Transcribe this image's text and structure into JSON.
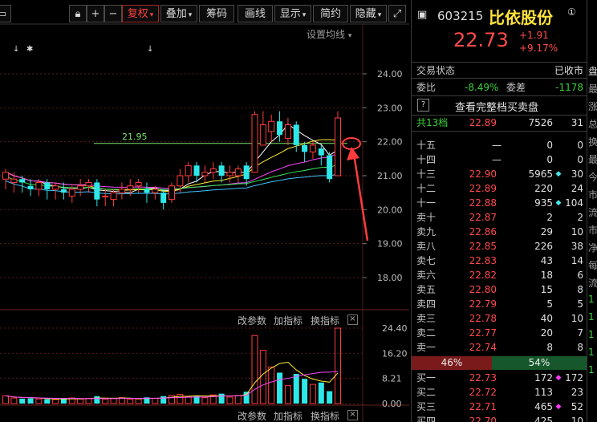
{
  "toolbar": {
    "icons": [
      "window-icon",
      "lock-icon",
      "plus-icon",
      "minus-icon"
    ],
    "fq_label": "复权",
    "overlay_label": "叠加",
    "chips_label": "筹码",
    "draw_label": "画线",
    "display_label": "显示",
    "simple_label": "简约",
    "hide_label": "隐藏",
    "expand_icon": "expand-icon"
  },
  "chart": {
    "ma_setting": "设置均线",
    "markers": [
      "↓",
      "✱",
      "↓"
    ],
    "ref_line_label": "21.95",
    "ref_line_price": 21.95,
    "y_ticks": [
      "24.00",
      "23.00",
      "22.00",
      "21.00",
      "20.00",
      "19.00",
      "18.00"
    ],
    "vol_ticks": [
      "24.40",
      "16.20",
      "8.21",
      "0.00"
    ],
    "vol_buttons": [
      "改参数",
      "加指标",
      "换指标"
    ],
    "bottom_buttons": [
      "改参数",
      "加指标",
      "换指标"
    ],
    "close_icon": "close-icon"
  },
  "chart_data": {
    "type": "candlestick",
    "price_range": [
      18.0,
      24.0
    ],
    "volume_range": [
      0,
      24.4
    ],
    "candles": [
      {
        "o": 20.9,
        "c": 21.1,
        "h": 21.2,
        "l": 20.6,
        "up": true
      },
      {
        "o": 20.8,
        "c": 20.9,
        "h": 21.1,
        "l": 20.5,
        "up": true
      },
      {
        "o": 20.9,
        "c": 20.8,
        "h": 21.0,
        "l": 20.5,
        "up": false
      },
      {
        "o": 20.7,
        "c": 20.6,
        "h": 20.9,
        "l": 20.4,
        "up": false
      },
      {
        "o": 20.6,
        "c": 20.8,
        "h": 20.9,
        "l": 20.4,
        "up": true
      },
      {
        "o": 20.8,
        "c": 20.6,
        "h": 20.9,
        "l": 20.3,
        "up": false
      },
      {
        "o": 20.6,
        "c": 20.7,
        "h": 20.8,
        "l": 20.3,
        "up": true
      },
      {
        "o": 20.6,
        "c": 20.5,
        "h": 20.8,
        "l": 20.3,
        "up": false
      },
      {
        "o": 20.4,
        "c": 20.6,
        "h": 20.7,
        "l": 20.2,
        "up": true
      },
      {
        "o": 20.6,
        "c": 20.7,
        "h": 20.9,
        "l": 20.4,
        "up": true
      },
      {
        "o": 20.7,
        "c": 20.8,
        "h": 20.9,
        "l": 20.5,
        "up": true
      },
      {
        "o": 20.8,
        "c": 20.3,
        "h": 20.9,
        "l": 20.1,
        "up": false
      },
      {
        "o": 20.4,
        "c": 20.4,
        "h": 20.6,
        "l": 20.1,
        "up": true
      },
      {
        "o": 20.3,
        "c": 20.5,
        "h": 20.6,
        "l": 20.1,
        "up": true
      },
      {
        "o": 20.5,
        "c": 20.6,
        "h": 20.8,
        "l": 20.3,
        "up": true
      },
      {
        "o": 20.6,
        "c": 20.7,
        "h": 20.9,
        "l": 20.4,
        "up": true
      },
      {
        "o": 20.7,
        "c": 20.8,
        "h": 20.9,
        "l": 20.5,
        "up": true
      },
      {
        "o": 20.6,
        "c": 20.5,
        "h": 20.8,
        "l": 20.2,
        "up": false
      },
      {
        "o": 20.5,
        "c": 20.6,
        "h": 20.7,
        "l": 20.3,
        "up": true
      },
      {
        "o": 20.5,
        "c": 20.2,
        "h": 20.6,
        "l": 20.0,
        "up": false
      },
      {
        "o": 20.3,
        "c": 20.7,
        "h": 20.8,
        "l": 20.2,
        "up": true
      },
      {
        "o": 20.7,
        "c": 21.0,
        "h": 21.2,
        "l": 20.5,
        "up": true
      },
      {
        "o": 21.0,
        "c": 21.3,
        "h": 21.4,
        "l": 20.8,
        "up": true
      },
      {
        "o": 21.3,
        "c": 21.0,
        "h": 21.4,
        "l": 20.8,
        "up": false
      },
      {
        "o": 21.0,
        "c": 21.1,
        "h": 21.3,
        "l": 20.8,
        "up": true
      },
      {
        "o": 21.1,
        "c": 21.2,
        "h": 21.4,
        "l": 20.9,
        "up": true
      },
      {
        "o": 21.3,
        "c": 21.0,
        "h": 21.4,
        "l": 20.8,
        "up": false
      },
      {
        "o": 21.0,
        "c": 21.1,
        "h": 21.3,
        "l": 20.8,
        "up": true
      },
      {
        "o": 21.0,
        "c": 21.2,
        "h": 21.3,
        "l": 20.8,
        "up": true
      },
      {
        "o": 21.3,
        "c": 20.9,
        "h": 21.4,
        "l": 20.7,
        "up": false
      },
      {
        "o": 21.1,
        "c": 22.8,
        "h": 22.9,
        "l": 21.1,
        "up": true
      },
      {
        "o": 21.9,
        "c": 22.5,
        "h": 22.9,
        "l": 21.9,
        "up": true
      },
      {
        "o": 22.3,
        "c": 22.6,
        "h": 22.8,
        "l": 22.0,
        "up": true
      },
      {
        "o": 22.6,
        "c": 22.2,
        "h": 22.9,
        "l": 22.0,
        "up": false
      },
      {
        "o": 22.1,
        "c": 22.5,
        "h": 22.7,
        "l": 21.9,
        "up": true
      },
      {
        "o": 22.5,
        "c": 21.9,
        "h": 22.6,
        "l": 21.7,
        "up": false
      },
      {
        "o": 21.9,
        "c": 21.7,
        "h": 22.0,
        "l": 21.4,
        "up": false
      },
      {
        "o": 21.7,
        "c": 21.9,
        "h": 22.0,
        "l": 21.5,
        "up": true
      },
      {
        "o": 21.8,
        "c": 21.6,
        "h": 21.9,
        "l": 21.3,
        "up": false
      },
      {
        "o": 21.6,
        "c": 20.9,
        "h": 21.7,
        "l": 20.8,
        "up": false
      },
      {
        "o": 21.0,
        "c": 22.7,
        "h": 22.9,
        "l": 21.0,
        "up": true
      }
    ],
    "volumes": [
      2.5,
      1.8,
      1.6,
      1.7,
      1.5,
      1.4,
      1.3,
      1.6,
      1.8,
      1.5,
      1.7,
      2.4,
      1.4,
      1.6,
      1.9,
      1.4,
      1.5,
      2.0,
      1.7,
      2.4,
      2.6,
      3.0,
      2.2,
      2.4,
      1.9,
      2.8,
      3.2,
      2.1,
      2.6,
      3.8,
      22.0,
      17.2,
      11.8,
      10.0,
      5.8,
      9.6,
      8.0,
      6.2,
      6.8,
      4.0,
      24.4
    ]
  },
  "quote": {
    "code": "603215",
    "name": "比依股份",
    "price": "22.73",
    "change": "+1.91",
    "change_pct": "+9.17%",
    "trade_status_label": "交易状态",
    "trade_status": "已收市",
    "weibi_label": "委比",
    "weibi": "-8.49%",
    "weicha_label": "委差",
    "weicha": "-1178",
    "help_icon": "?",
    "full_book_label": "查看完整档买卖盘",
    "total_label": "共13档",
    "total_price": "22.89",
    "total_vol": "7526",
    "total_cnt": "31",
    "asks": [
      {
        "name": "十五",
        "price": "",
        "vol": "0",
        "cnt": "0",
        "flag": "",
        "dash": "—"
      },
      {
        "name": "十四",
        "price": "",
        "vol": "0",
        "cnt": "0",
        "flag": "",
        "dash": "—"
      },
      {
        "name": "十三",
        "price": "22.90",
        "vol": "5965",
        "cnt": "30",
        "flag": "cyan"
      },
      {
        "name": "十二",
        "price": "22.89",
        "vol": "220",
        "cnt": "24",
        "flag": ""
      },
      {
        "name": "十一",
        "price": "22.88",
        "vol": "935",
        "cnt": "104",
        "flag": "cyan"
      },
      {
        "name": "卖十",
        "price": "22.87",
        "vol": "2",
        "cnt": "2",
        "flag": ""
      },
      {
        "name": "卖九",
        "price": "22.86",
        "vol": "29",
        "cnt": "10",
        "flag": ""
      },
      {
        "name": "卖八",
        "price": "22.85",
        "vol": "226",
        "cnt": "38",
        "flag": ""
      },
      {
        "name": "卖七",
        "price": "22.83",
        "vol": "43",
        "cnt": "14",
        "flag": ""
      },
      {
        "name": "卖六",
        "price": "22.82",
        "vol": "18",
        "cnt": "6",
        "flag": ""
      },
      {
        "name": "卖五",
        "price": "22.80",
        "vol": "15",
        "cnt": "8",
        "flag": ""
      },
      {
        "name": "卖四",
        "price": "22.79",
        "vol": "5",
        "cnt": "5",
        "flag": ""
      },
      {
        "name": "卖三",
        "price": "22.78",
        "vol": "40",
        "cnt": "10",
        "flag": ""
      },
      {
        "name": "卖二",
        "price": "22.77",
        "vol": "20",
        "cnt": "7",
        "flag": ""
      },
      {
        "name": "卖一",
        "price": "22.74",
        "vol": "8",
        "cnt": "8",
        "flag": ""
      }
    ],
    "sell_ratio": "46%",
    "buy_ratio": "54%",
    "bids": [
      {
        "name": "买一",
        "price": "22.73",
        "vol": "172",
        "cnt": "172",
        "flag": "mag"
      },
      {
        "name": "买二",
        "price": "22.72",
        "vol": "113",
        "cnt": "23",
        "flag": ""
      },
      {
        "name": "买三",
        "price": "22.71",
        "vol": "465",
        "cnt": "52",
        "flag": "mag"
      },
      {
        "name": "买四",
        "price": "22.70",
        "vol": "425",
        "cnt": "10",
        "flag": ""
      }
    ],
    "colors": {
      "up": "#ff4b4b",
      "down": "#3ff0f0",
      "neutral": "#e0e0e0",
      "green": "#39d239"
    }
  },
  "sidestrip": {
    "chars": [
      "盘",
      "最",
      "涨",
      "总",
      "换",
      "最",
      "今",
      "市",
      "流",
      "市",
      "净",
      "每",
      "流",
      "1",
      "1",
      "1",
      "1",
      "1"
    ]
  }
}
